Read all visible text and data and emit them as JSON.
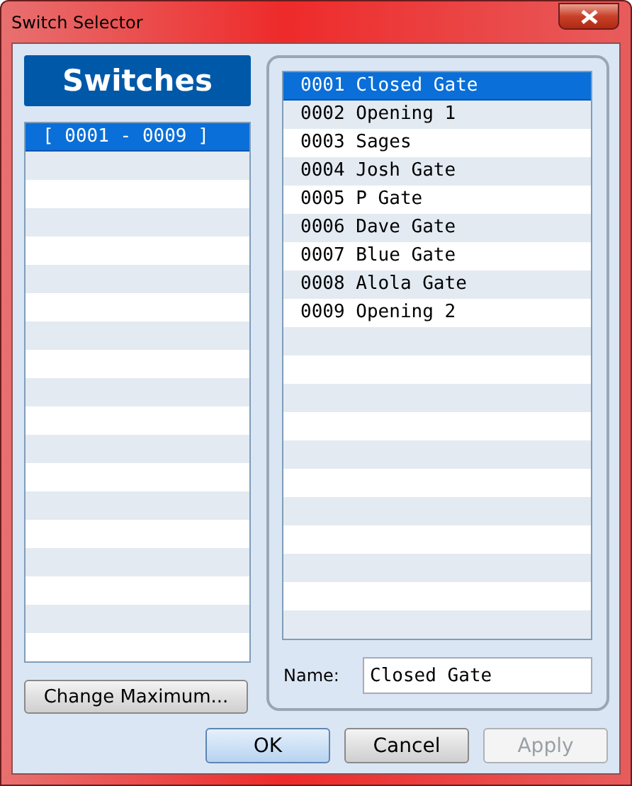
{
  "window": {
    "title": "Switch Selector"
  },
  "header": "Switches",
  "groups": [
    {
      "label": "[ 0001 - 0009 ]",
      "selected": true
    }
  ],
  "change_maximum_button": "Change Maximum...",
  "switches": [
    {
      "label": "0001 Closed Gate",
      "selected": true
    },
    {
      "label": "0002 Opening 1",
      "selected": false
    },
    {
      "label": "0003 Sages",
      "selected": false
    },
    {
      "label": "0004 Josh Gate",
      "selected": false
    },
    {
      "label": "0005 P Gate",
      "selected": false
    },
    {
      "label": "0006 Dave Gate",
      "selected": false
    },
    {
      "label": "0007 Blue Gate",
      "selected": false
    },
    {
      "label": "0008 Alola Gate",
      "selected": false
    },
    {
      "label": "0009 Opening 2",
      "selected": false
    }
  ],
  "name_field": {
    "label": "Name:",
    "value": "Closed Gate"
  },
  "buttons": [
    {
      "label": "OK",
      "kind": "default",
      "disabled": false
    },
    {
      "label": "Cancel",
      "kind": "normal",
      "disabled": false
    },
    {
      "label": "Apply",
      "kind": "normal",
      "disabled": true
    }
  ]
}
